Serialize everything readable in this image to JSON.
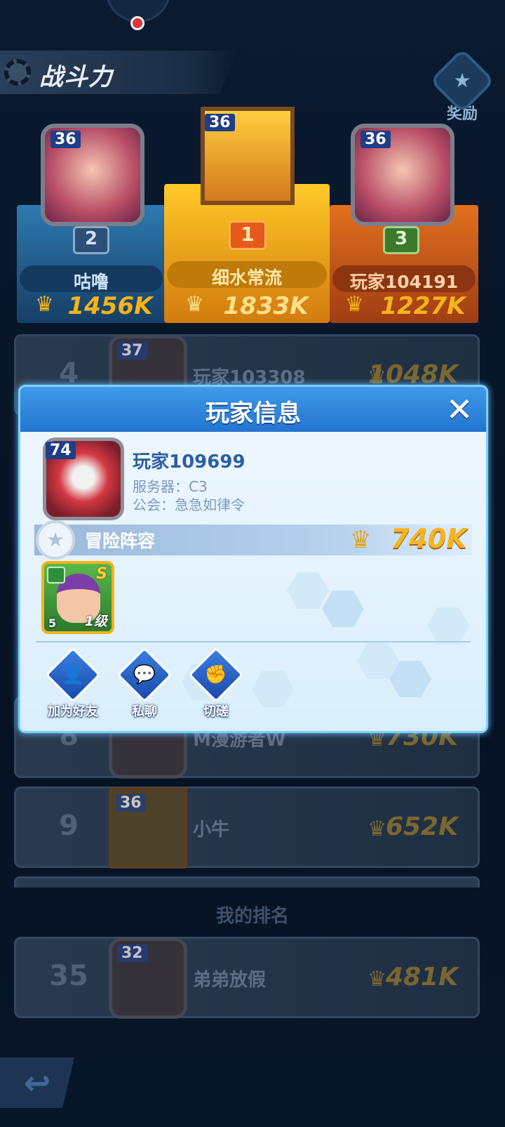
{
  "header": {
    "tab_label": "战斗力",
    "reward_label": "奖励"
  },
  "podium": [
    {
      "rank_label": "2",
      "level": "36",
      "name": "咕噜",
      "score": "1456K"
    },
    {
      "rank_label": "1",
      "level": "36",
      "name": "细水常流",
      "score": "1833K"
    },
    {
      "rank_label": "3",
      "level": "36",
      "name": "玩家104191",
      "score": "1227K"
    }
  ],
  "ranking_rows": [
    {
      "rank": "4",
      "level": "37",
      "name": "玩家103308",
      "score": "1048K"
    },
    {
      "rank": "8",
      "level": "",
      "name": "M漫游者W",
      "score": "730K"
    },
    {
      "rank": "9",
      "level": "36",
      "name": "小牛",
      "score": "652K"
    }
  ],
  "my_rank": {
    "section_label": "我的排名",
    "rank": "35",
    "level": "32",
    "name": "弟弟放假",
    "score": "481K"
  },
  "modal": {
    "title": "玩家信息",
    "close_glyph": "✕",
    "player": {
      "level": "74",
      "name": "玩家109699",
      "server": "服务器：C3",
      "guild": "公会：急急如律令"
    },
    "lineup_label": "冒险阵容",
    "power": "740K",
    "hero": {
      "grade": "S",
      "stars": "5",
      "level": "1级"
    },
    "actions": [
      {
        "label": "加为好友",
        "icon": "add-friend-icon"
      },
      {
        "label": "私聊",
        "icon": "chat-bubble-icon"
      },
      {
        "label": "切磋",
        "icon": "fist-bump-icon"
      }
    ]
  },
  "colors": {
    "modal_header": "#2f86dd",
    "power_gold": "#f5b425",
    "podium_gold": "#f5b319",
    "podium_blue": "#1e5e8c",
    "podium_orange": "#c45a20"
  }
}
